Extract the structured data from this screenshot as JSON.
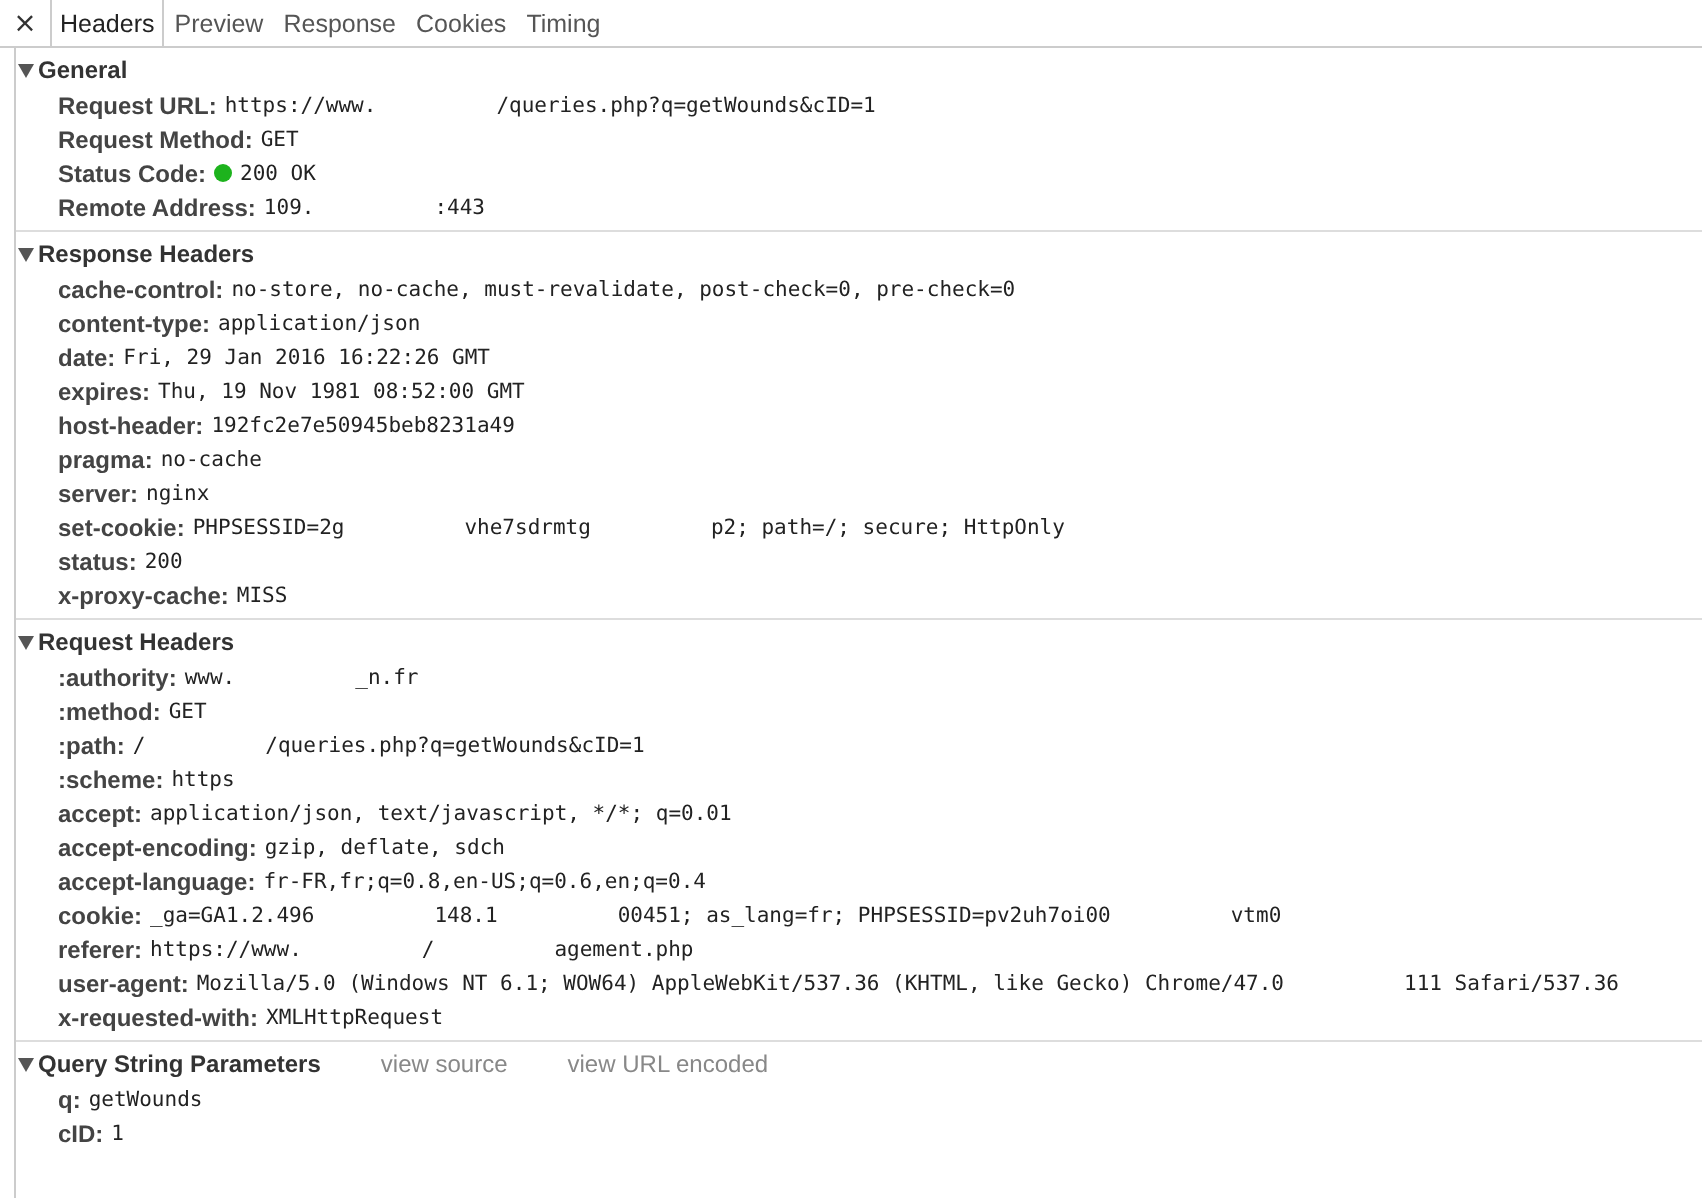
{
  "close": "×",
  "tabs": [
    {
      "label": "Headers",
      "selected": true
    },
    {
      "label": "Preview",
      "selected": false
    },
    {
      "label": "Response",
      "selected": false
    },
    {
      "label": "Cookies",
      "selected": false
    },
    {
      "label": "Timing",
      "selected": false
    }
  ],
  "sections": [
    {
      "title": "General",
      "expanded": true,
      "rows": [
        {
          "key": "Request URL:",
          "values": [
            "https://www.",
            "/queries.php?q=getWounds&cID=1"
          ]
        },
        {
          "key": "Request Method:",
          "values": [
            "GET"
          ]
        },
        {
          "key": "Status Code:",
          "values": [
            "200 OK"
          ],
          "color": "#1db31d"
        },
        {
          "key": "Remote Address:",
          "values": [
            "109.",
            ":443"
          ]
        }
      ]
    },
    {
      "title": "Response Headers",
      "expanded": true,
      "rows": [
        {
          "key": "cache-control:",
          "values": [
            "no-store, no-cache, must-revalidate, post-check=0, pre-check=0"
          ]
        },
        {
          "key": "content-type:",
          "values": [
            "application/json"
          ]
        },
        {
          "key": "date:",
          "values": [
            "Fri, 29 Jan 2016 16:22:26 GMT"
          ]
        },
        {
          "key": "expires:",
          "values": [
            "Thu, 19 Nov 1981 08:52:00 GMT"
          ]
        },
        {
          "key": "host-header:",
          "values": [
            "192fc2e7e50945beb8231a49"
          ]
        },
        {
          "key": "pragma:",
          "values": [
            "no-cache"
          ]
        },
        {
          "key": "server:",
          "values": [
            "nginx"
          ]
        },
        {
          "key": "set-cookie:",
          "values": [
            "PHPSESSID=2g",
            "vhe7sdrmtg",
            "p2; path=/; secure; HttpOnly"
          ]
        },
        {
          "key": "status:",
          "values": [
            "200"
          ]
        },
        {
          "key": "x-proxy-cache:",
          "values": [
            "MISS"
          ]
        }
      ]
    },
    {
      "title": "Request Headers",
      "expanded": true,
      "rows": [
        {
          "key": ":authority:",
          "values": [
            "www.",
            "_n.fr"
          ]
        },
        {
          "key": ":method:",
          "values": [
            "GET"
          ]
        },
        {
          "key": ":path:",
          "values": [
            "/",
            "/queries.php?q=getWounds&cID=1"
          ]
        },
        {
          "key": ":scheme:",
          "values": [
            "https"
          ]
        },
        {
          "key": "accept:",
          "values": [
            "application/json, text/javascript, */*; q=0.01"
          ]
        },
        {
          "key": "accept-encoding:",
          "values": [
            "gzip, deflate, sdch"
          ]
        },
        {
          "key": "accept-language:",
          "values": [
            "fr-FR,fr;q=0.8,en-US;q=0.6,en;q=0.4"
          ]
        },
        {
          "key": "cookie:",
          "values": [
            "_ga=GA1.2.496",
            "148.1",
            "00451; as_lang=fr; PHPSESSID=pv2uh7oi00",
            "vtm0"
          ]
        },
        {
          "key": "referer:",
          "values": [
            "https://www.",
            "/",
            "agement.php"
          ]
        },
        {
          "key": "user-agent:",
          "values": [
            "Mozilla/5.0 (Windows NT 6.1; WOW64) AppleWebKit/537.36 (KHTML, like Gecko) Chrome/47.0",
            "111 Safari/537.36"
          ]
        },
        {
          "key": "x-requested-with:",
          "values": [
            "XMLHttpRequest"
          ]
        }
      ]
    },
    {
      "title": "Query String Parameters",
      "expanded": true,
      "links": [
        "view source",
        "view URL encoded"
      ],
      "rows": [
        {
          "key": "q:",
          "values": [
            "getWounds"
          ]
        },
        {
          "key": "cID:",
          "values": [
            "1"
          ]
        }
      ]
    }
  ]
}
